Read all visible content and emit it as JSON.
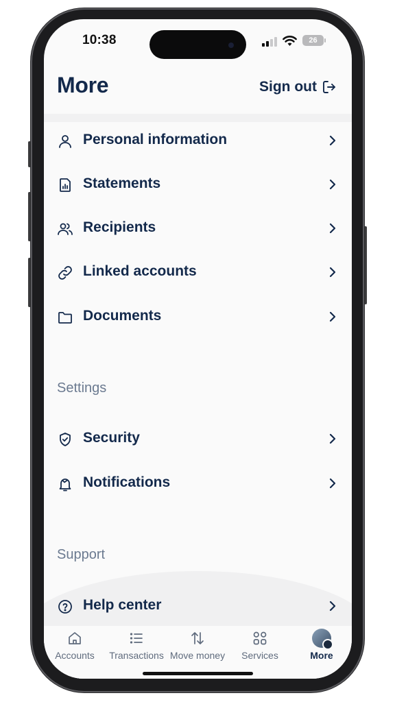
{
  "status": {
    "time": "10:38",
    "battery": "26"
  },
  "header": {
    "title": "More",
    "sign_out": "Sign out"
  },
  "account_items": [
    {
      "label": "Personal information",
      "icon": "user-icon"
    },
    {
      "label": "Statements",
      "icon": "statement-icon"
    },
    {
      "label": "Recipients",
      "icon": "recipients-icon"
    },
    {
      "label": "Linked accounts",
      "icon": "link-icon"
    },
    {
      "label": "Documents",
      "icon": "folder-icon"
    }
  ],
  "settings": {
    "heading": "Settings",
    "items": [
      {
        "label": "Security",
        "icon": "shield-check-icon"
      },
      {
        "label": "Notifications",
        "icon": "bell-icon"
      }
    ]
  },
  "support": {
    "heading": "Support",
    "items": [
      {
        "label": "Help center",
        "icon": "help-circle-icon"
      }
    ]
  },
  "tabs": [
    {
      "label": "Accounts",
      "icon": "home-icon",
      "active": false
    },
    {
      "label": "Transactions",
      "icon": "list-icon",
      "active": false
    },
    {
      "label": "Move money",
      "icon": "transfer-arrows-icon",
      "active": false
    },
    {
      "label": "Services",
      "icon": "grid-icon",
      "active": false
    },
    {
      "label": "More",
      "icon": "avatar-icon",
      "active": true
    }
  ],
  "colors": {
    "primary": "#13294b",
    "muted": "#6b7a90",
    "background": "#fafafa"
  }
}
